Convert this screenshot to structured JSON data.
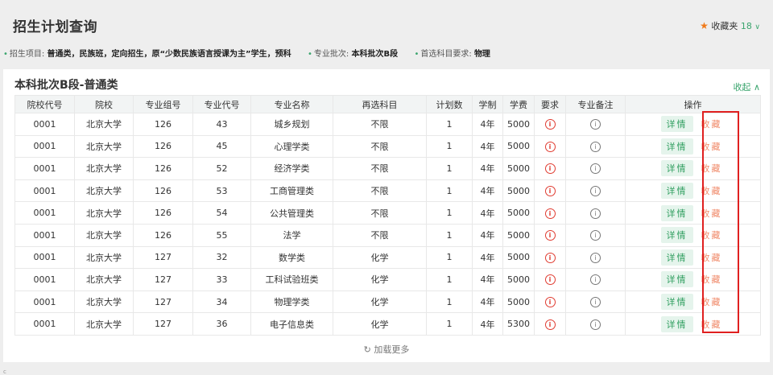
{
  "page": {
    "title": "招生计划查询",
    "favorites": {
      "label": "收藏夹",
      "count": "18",
      "icon": "star-icon"
    }
  },
  "filters": [
    {
      "label": "招生项目:",
      "value": "普通类，民族班，定向招生，原“少数民族语言授课为主”学生，预科"
    },
    {
      "label": "专业批次:",
      "value": "本科批次B段"
    },
    {
      "label": "首选科目要求:",
      "value": "物理"
    }
  ],
  "section": {
    "title": "本科批次B段-普通类",
    "collapse_label": "收起"
  },
  "table": {
    "headers": [
      "院校代号",
      "院校",
      "专业组号",
      "专业代号",
      "专业名称",
      "再选科目",
      "计划数",
      "学制",
      "学费",
      "要求",
      "专业备注",
      "操作"
    ],
    "detail_label": "详情",
    "fav_label": "收藏",
    "rows": [
      [
        "0001",
        "北京大学",
        "126",
        "43",
        "城乡规划",
        "不限",
        "1",
        "4年",
        "5000"
      ],
      [
        "0001",
        "北京大学",
        "126",
        "45",
        "心理学类",
        "不限",
        "1",
        "4年",
        "5000"
      ],
      [
        "0001",
        "北京大学",
        "126",
        "52",
        "经济学类",
        "不限",
        "1",
        "4年",
        "5000"
      ],
      [
        "0001",
        "北京大学",
        "126",
        "53",
        "工商管理类",
        "不限",
        "1",
        "4年",
        "5000"
      ],
      [
        "0001",
        "北京大学",
        "126",
        "54",
        "公共管理类",
        "不限",
        "1",
        "4年",
        "5000"
      ],
      [
        "0001",
        "北京大学",
        "126",
        "55",
        "法学",
        "不限",
        "1",
        "4年",
        "5000"
      ],
      [
        "0001",
        "北京大学",
        "127",
        "32",
        "数学类",
        "化学",
        "1",
        "4年",
        "5000"
      ],
      [
        "0001",
        "北京大学",
        "127",
        "33",
        "工科试验班类",
        "化学",
        "1",
        "4年",
        "5000"
      ],
      [
        "0001",
        "北京大学",
        "127",
        "34",
        "物理学类",
        "化学",
        "1",
        "4年",
        "5000"
      ],
      [
        "0001",
        "北京大学",
        "127",
        "36",
        "电子信息类",
        "化学",
        "1",
        "4年",
        "5300"
      ]
    ]
  },
  "load_more": "加载更多",
  "colors": {
    "accent": "#3ba56e",
    "star": "#f07a1a",
    "warning": "#e03c31",
    "highlight": "#e02020"
  }
}
